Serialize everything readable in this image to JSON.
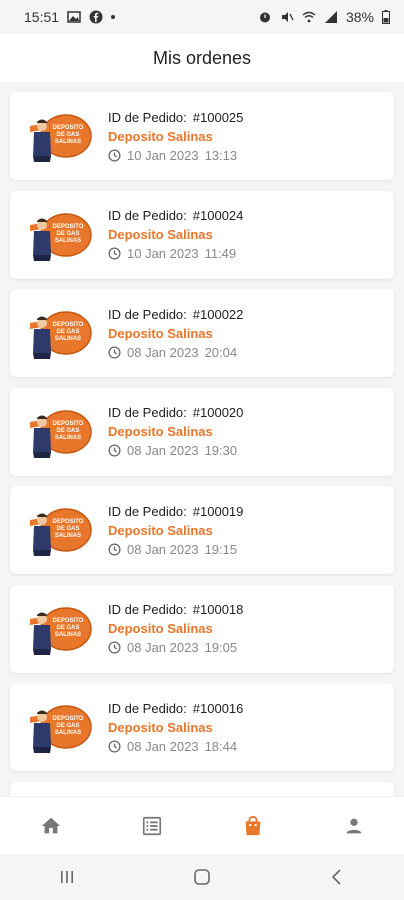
{
  "status_bar": {
    "time": "15:51",
    "battery": "38%"
  },
  "header": {
    "title": "Mis ordenes"
  },
  "orders": [
    {
      "id_label": "ID de Pedido:",
      "id": "#100025",
      "store": "Deposito Salinas",
      "date": "10 Jan 2023",
      "time": "13:13"
    },
    {
      "id_label": "ID de Pedido:",
      "id": "#100024",
      "store": "Deposito Salinas",
      "date": "10 Jan 2023",
      "time": "11:49"
    },
    {
      "id_label": "ID de Pedido:",
      "id": "#100022",
      "store": "Deposito Salinas",
      "date": "08 Jan 2023",
      "time": "20:04"
    },
    {
      "id_label": "ID de Pedido:",
      "id": "#100020",
      "store": "Deposito Salinas",
      "date": "08 Jan 2023",
      "time": "19:30"
    },
    {
      "id_label": "ID de Pedido:",
      "id": "#100019",
      "store": "Deposito Salinas",
      "date": "08 Jan 2023",
      "time": "19:15"
    },
    {
      "id_label": "ID de Pedido:",
      "id": "#100018",
      "store": "Deposito Salinas",
      "date": "08 Jan 2023",
      "time": "19:05"
    },
    {
      "id_label": "ID de Pedido:",
      "id": "#100016",
      "store": "Deposito Salinas",
      "date": "08 Jan 2023",
      "time": "18:44"
    }
  ],
  "logo": {
    "text_line1": "DEPOSITO",
    "text_line2": "DE GAS",
    "text_line3": "SALINAS"
  },
  "bottom_nav": {
    "items": [
      {
        "icon": "home-icon",
        "active": false
      },
      {
        "icon": "list-icon",
        "active": false
      },
      {
        "icon": "shopping-bag-icon",
        "active": true
      },
      {
        "icon": "person-icon",
        "active": false
      }
    ]
  },
  "colors": {
    "accent": "#e8762b",
    "inactive_icon": "#777777",
    "background": "#f5f5f5"
  }
}
